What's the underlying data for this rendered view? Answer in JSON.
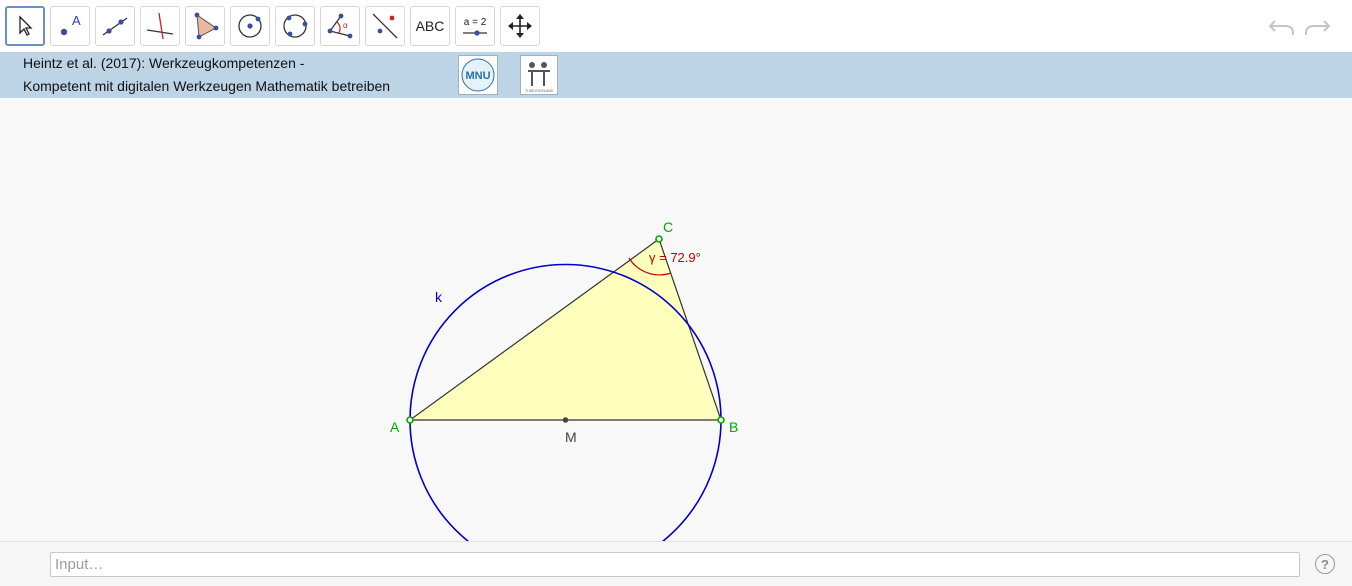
{
  "toolbar": {
    "tools": [
      {
        "name": "move-tool",
        "selected": true
      },
      {
        "name": "point-tool",
        "glyph_label": "A"
      },
      {
        "name": "line-tool"
      },
      {
        "name": "perpendicular-line-tool"
      },
      {
        "name": "polygon-tool"
      },
      {
        "name": "circle-center-point-tool"
      },
      {
        "name": "circle-three-points-tool"
      },
      {
        "name": "angle-tool",
        "glyph_label": "α"
      },
      {
        "name": "reflect-tool"
      },
      {
        "name": "text-tool",
        "label": "ABC"
      },
      {
        "name": "slider-tool",
        "label": "a = 2"
      },
      {
        "name": "move-graphics-view-tool"
      }
    ],
    "undo_icon": "undo-icon",
    "redo_icon": "redo-icon"
  },
  "banner": {
    "line1": "Heintz et al. (2017): Werkzeugkompetenzen -",
    "line2": "Kompetent mit digitalen Werkzeugen Mathematik betreiben",
    "logo1_text": "MNU",
    "logo2_text": "T³ DEUTSCHLAND"
  },
  "construction": {
    "labels": {
      "A": "A",
      "B": "B",
      "C": "C",
      "M": "M",
      "k": "k",
      "angle": "γ = 72.9°"
    },
    "colors": {
      "point_label": "#00aa00",
      "circle": "#0000cc",
      "polygon_fill": "#ffffb3",
      "angle": "#cc0000",
      "midpoint": "#444444"
    }
  },
  "input": {
    "placeholder": "Input…",
    "value": ""
  },
  "help": {
    "label": "?"
  }
}
